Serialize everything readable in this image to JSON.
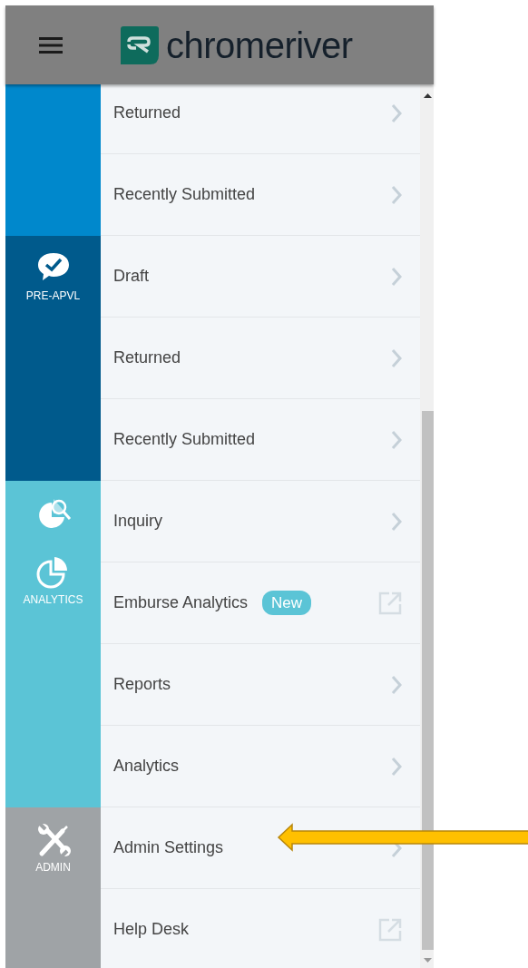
{
  "header": {
    "logo_text": "chromeriver"
  },
  "sections": [
    {
      "color": "#0088cc",
      "items": [
        {
          "label": "Returned",
          "kind": "chevron"
        },
        {
          "label": "Recently Submitted",
          "kind": "chevron"
        }
      ]
    },
    {
      "color": "#005a8c",
      "tiles": [
        {
          "kind": "check",
          "label": "PRE-APVL"
        }
      ],
      "items": [
        {
          "label": "Draft",
          "kind": "chevron"
        },
        {
          "label": "Returned",
          "kind": "chevron"
        },
        {
          "label": "Recently Submitted",
          "kind": "chevron"
        }
      ]
    },
    {
      "color": "#5bc4d6",
      "tiles": [
        {
          "kind": "inquiry"
        },
        {
          "kind": "analytics",
          "label": "ANALYTICS"
        }
      ],
      "items": [
        {
          "label": "Inquiry",
          "kind": "chevron"
        },
        {
          "label": "Emburse Analytics",
          "kind": "external",
          "badge": "New"
        },
        {
          "label": "Reports",
          "kind": "chevron"
        },
        {
          "label": "Analytics",
          "kind": "chevron"
        }
      ]
    },
    {
      "color": "#9fa3a6",
      "tiles": [
        {
          "kind": "admin",
          "label": "ADMIN"
        }
      ],
      "items": [
        {
          "label": "Admin Settings",
          "kind": "chevron"
        },
        {
          "label": "Help Desk",
          "kind": "external"
        }
      ]
    }
  ]
}
